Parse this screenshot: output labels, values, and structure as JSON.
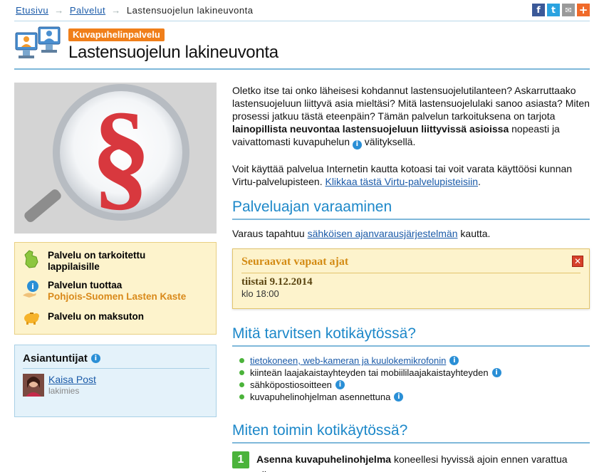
{
  "breadcrumb": {
    "home": "Etusivu",
    "services": "Palvelut",
    "current": "Lastensuojelun lakineuvonta",
    "separator": "→"
  },
  "share": {
    "facebook_glyph": "f",
    "twitter_glyph": "t",
    "mail_glyph": "✉",
    "plus_glyph": "+"
  },
  "header": {
    "badge": "Kuvapuhelinpalvelu",
    "title": "Lastensuojelun lakineuvonta"
  },
  "hero_image": {
    "symbol": "§"
  },
  "info_box": {
    "target": "Palvelu on tarkoitettu lappilaisille",
    "provider_label": "Palvelun tuottaa",
    "provider_name": "Pohjois-Suomen Lasten Kaste",
    "price": "Palvelu on maksuton"
  },
  "experts": {
    "title": "Asiantuntijat",
    "name": "Kaisa Post",
    "role": "lakimies"
  },
  "intro": {
    "p1_before": "Oletko itse tai onko läheisesi kohdannut lastensuojelutilanteen? Askarruttaako lastensuojeluun liittyvä asia mieltäsi? Mitä lastensuojelulaki sanoo asiasta? Miten prosessi jatkuu tästä eteenpäin? Tämän palvelun tarkoituksena on tarjota ",
    "p1_bold": "lainopillista neuvontaa lastensuojeluun liittyvissä asioissa",
    "p1_after": " nopeasti ja vaivattomasti kuvapuhelun",
    "p1_end": " välityksellä.",
    "p2_text": "Voit käyttää palvelua Internetin kautta kotoasi tai voit varata käyttöösi kunnan Virtu-palvelupisteen. ",
    "p2_link": "Klikkaa tästä Virtu-palvelupisteisiin",
    "p2_end": "."
  },
  "booking": {
    "heading": "Palveluajan varaaminen",
    "text_before": "Varaus tapahtuu ",
    "link": "sähköisen ajanvarausjärjestelmän",
    "text_after": " kautta."
  },
  "slots": {
    "title": "Seuraavat vapaat ajat",
    "close": "✕",
    "date": "tiistai 9.12.2014",
    "time": "klo 18:00"
  },
  "requirements": {
    "heading": "Mitä tarvitsen kotikäytössä?",
    "items": [
      "tietokoneen, web-kameran ja kuulokemikrofonin",
      "kiinteän laajakaistayhteyden tai mobiililaajakaistayhteyden",
      "sähköpostiosoitteen",
      "kuvapuhelinohjelman asennettuna"
    ]
  },
  "howto": {
    "heading": "Miten toimin kotikäytössä?",
    "step1_num": "1",
    "step1_bold": "Asenna kuvapuhelinohjelma",
    "step1_text": " koneellesi hyvissä ajoin ennen varattua aikaa."
  },
  "colors": {
    "accent_blue": "#1d88c9",
    "badge_orange": "#f07f1a",
    "info_yellow": "#fdf3cc",
    "green": "#4bb33b"
  }
}
